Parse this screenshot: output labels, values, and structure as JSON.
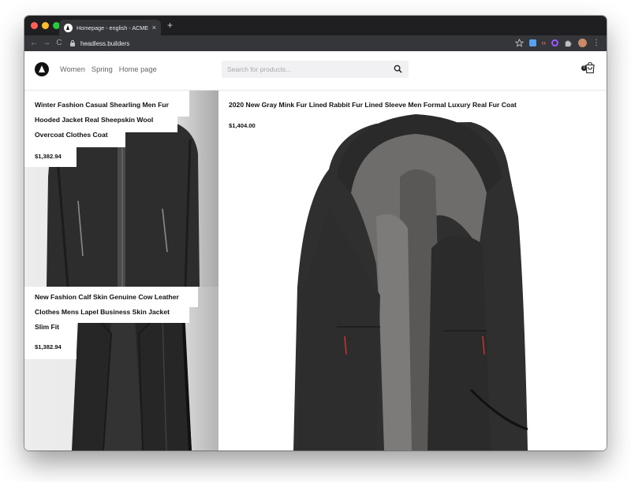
{
  "browser": {
    "tab_title": "Homepage - english - ACME S",
    "tab_close": "×",
    "new_tab": "+",
    "url": "headless.builders",
    "nav_back": "←",
    "nav_forward": "→",
    "nav_reload": "C",
    "ext_code": "‹›",
    "extensions_icon": "puzzle-icon",
    "menu": "⋮"
  },
  "header": {
    "logo_icon": "triangle-logo-icon",
    "nav": [
      {
        "label": "Women"
      },
      {
        "label": "Spring"
      },
      {
        "label": "Home page"
      }
    ],
    "search_placeholder": "Search for products...",
    "search_icon": "magnifier-icon",
    "cart_icon": "bag-icon",
    "cart_count": "1"
  },
  "products": [
    {
      "name_lines": [
        "Winter Fashion Casual Shearling Men Fur",
        "Hooded Jacket Real Sheepskin Wool",
        "Overcoat Clothes Coat"
      ],
      "price": "$1,382.94"
    },
    {
      "name_lines": [
        "New Fashion Calf Skin Genuine Cow Leather",
        "Clothes Mens Lapel Business Skin Jacket",
        "Slim Fit"
      ],
      "price": "$1,382.94"
    },
    {
      "name_lines": [
        "2020 New Gray Mink Fur Lined Rabbit Fur Lined Sleeve Men Formal Luxury Real Fur Coat"
      ],
      "price": "$1,404.00"
    }
  ],
  "colors": {
    "chrome_dark": "#1f1f21",
    "chrome_toolbar": "#35363a",
    "coat_black": "#2b2b2b",
    "fur_gray": "#6f6d6c"
  }
}
